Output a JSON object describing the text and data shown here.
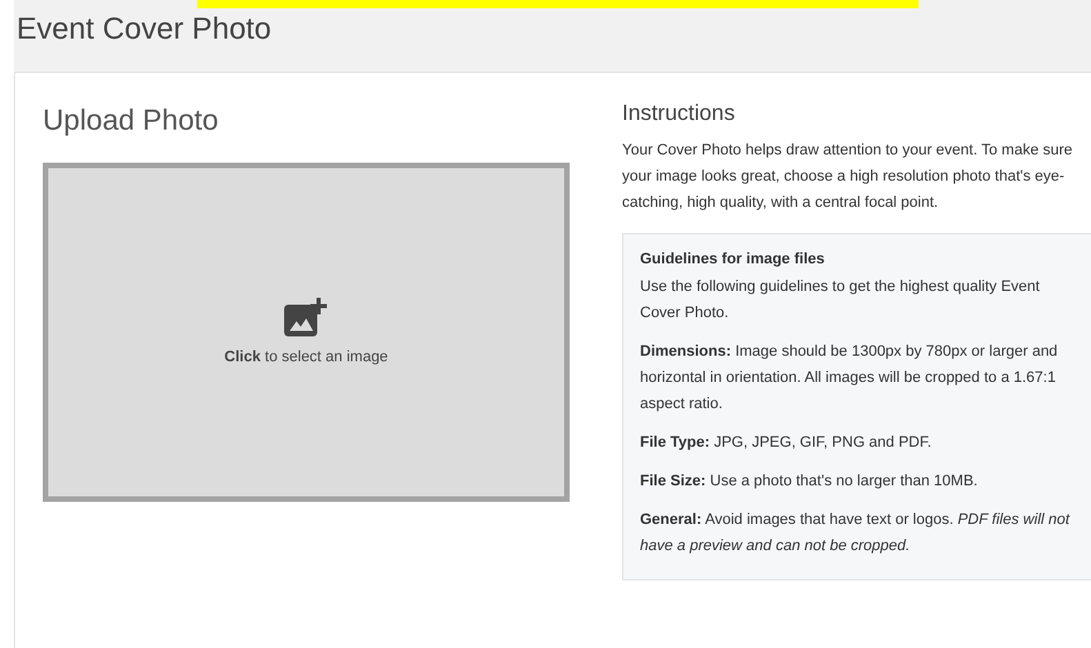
{
  "page_title": "Event Cover Photo",
  "upload": {
    "heading": "Upload Photo",
    "prompt": "**Click** to select an image"
  },
  "instructions": {
    "heading": "Instructions",
    "text": "Your Cover Photo helps draw attention to your event. To make sure your image looks great, choose a high resolution photo that's eye-catching, high quality, with a central focal point."
  },
  "guidelines": {
    "heading": "Guidelines for image files",
    "items": [
      {
        "text": "Use the following guidelines to get the highest quality Event Cover Photo."
      },
      {
        "text": "**Dimensions:** Image should be 1300px by 780px or larger and horizontal in orientation. All images will be cropped to a 1.67:1 aspect ratio."
      },
      {
        "text": "**File Type:** JPG, JPEG, GIF, PNG and PDF."
      },
      {
        "text": "**File Size:** Use a photo that's no larger than 10MB."
      },
      {
        "text": "**General:** Avoid images that have text or logos. *PDF files will not have a preview and can not be cropped.*"
      }
    ]
  }
}
